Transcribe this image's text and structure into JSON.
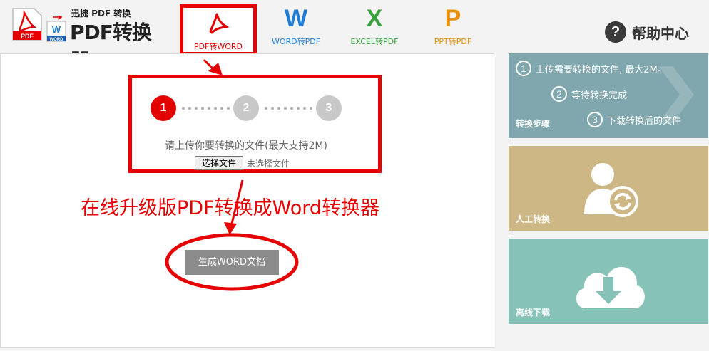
{
  "logo": {
    "subtitle": "迅捷 PDF 转换",
    "title": "PDF转换器",
    "pdf_badge": "PDF",
    "word_badge": "WORD"
  },
  "tabs": [
    {
      "glyph": "A",
      "label": "PDF转WORD",
      "color": "#e60000",
      "active": true
    },
    {
      "glyph": "W",
      "label": "WORD转PDF",
      "color": "#1f7ed6"
    },
    {
      "glyph": "X",
      "label": "EXCEL转PDF",
      "color": "#36a03a"
    },
    {
      "glyph": "P",
      "label": "PPT转PDF",
      "color": "#e8900c"
    }
  ],
  "help": {
    "icon": "?",
    "label": "帮助中心"
  },
  "steps": [
    {
      "number": "1"
    },
    {
      "number": "2"
    },
    {
      "number": "3"
    }
  ],
  "upload": {
    "hint": "请上传你要转换的文件(最大支持2M)",
    "button": "选择文件",
    "status": "未选择文件"
  },
  "promo_text": "在线升级版PDF转换成Word转换器",
  "generate_button": "生成WORD文档",
  "cards": {
    "steps": {
      "title": "转换步骤",
      "items": [
        {
          "num": "1",
          "text": "上传需要转换的文件, 最大2M。"
        },
        {
          "num": "2",
          "text": "等待转换完成"
        },
        {
          "num": "3",
          "text": "下载转换后的文件"
        }
      ]
    },
    "manual": {
      "title": "人工转换"
    },
    "offline": {
      "title": "离线下载"
    }
  },
  "colors": {
    "accent_red": "#e60000",
    "card_steps": "#7fa7ad",
    "card_manual": "#cdb785",
    "card_offline": "#87c2b8"
  }
}
